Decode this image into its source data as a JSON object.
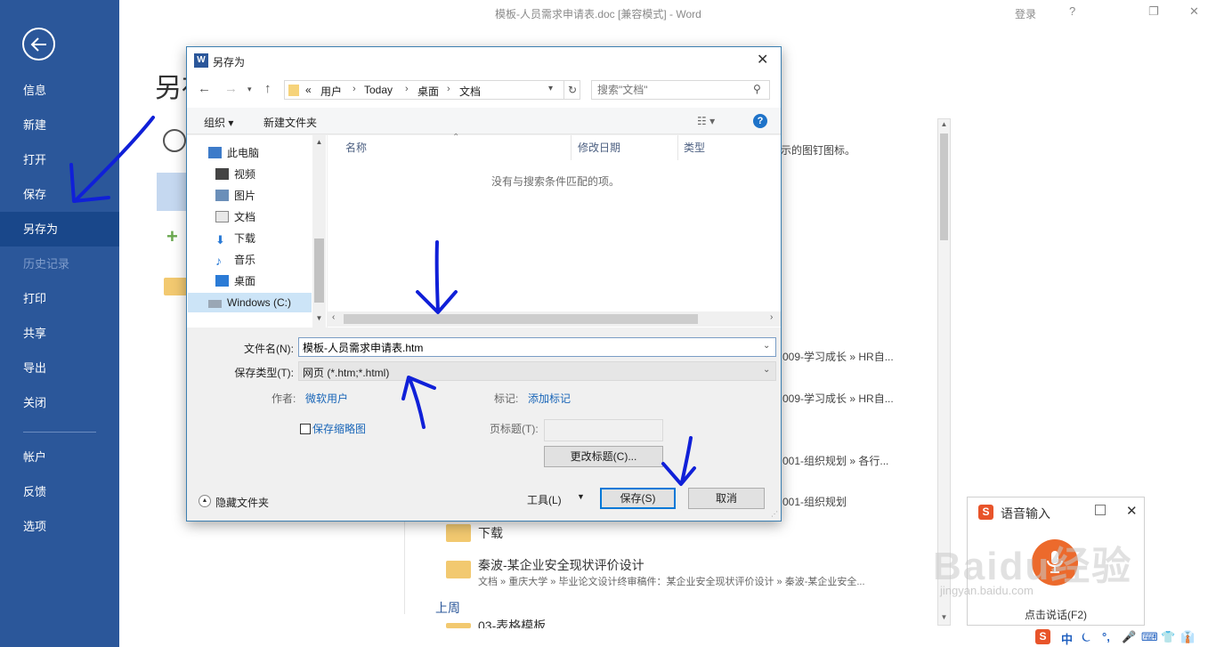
{
  "window": {
    "title": "模板-人员需求申请表.doc [兼容模式]  -  Word",
    "login": "登录",
    "help": "?",
    "restore": "❐",
    "close": "✕"
  },
  "backstage": {
    "heading": "另存",
    "nav": [
      {
        "label": "信息"
      },
      {
        "label": "新建"
      },
      {
        "label": "打开"
      },
      {
        "label": "保存"
      },
      {
        "label": "另存为"
      },
      {
        "label": "历史记录"
      },
      {
        "label": "打印"
      },
      {
        "label": "共享"
      },
      {
        "label": "导出"
      },
      {
        "label": "关闭"
      },
      {
        "label": "帐户"
      },
      {
        "label": "反馈"
      },
      {
        "label": "选项"
      }
    ],
    "pin_tip": "示的图钉图标。",
    "recent": [
      {
        "path": "009-学习成长 » HR自..."
      },
      {
        "path": "009-学习成长 » HR自..."
      },
      {
        "path": "001-组织规划 » 各行..."
      },
      {
        "path": "001-组织规划"
      }
    ],
    "folder_download": "下载",
    "folder_qinbo": "秦波-某企业安全现状评价设计",
    "folder_qinbo_path": "文档 » 重庆大学 » 毕业论文设计终审稿件：某企业安全现状评价设计 » 秦波-某企业安全...",
    "group_last_week": "上周",
    "folder_partial": "03-表格模板"
  },
  "dialog": {
    "title": "另存为",
    "close": "✕",
    "breadcrumb": {
      "overflow": "«",
      "items": [
        "用户",
        "Today",
        "桌面",
        "文档"
      ]
    },
    "search_placeholder": "搜索\"文档\"",
    "toolbar": {
      "organize": "组织 ▾",
      "new_folder": "新建文件夹",
      "help": "?"
    },
    "tree": [
      {
        "label": "此电脑",
        "icon": "computer-icon"
      },
      {
        "label": "视频",
        "icon": "video-icon"
      },
      {
        "label": "图片",
        "icon": "picture-icon"
      },
      {
        "label": "文档",
        "icon": "document-icon"
      },
      {
        "label": "下载",
        "icon": "download-icon"
      },
      {
        "label": "音乐",
        "icon": "music-icon"
      },
      {
        "label": "桌面",
        "icon": "desktop-icon"
      },
      {
        "label": "Windows (C:)",
        "icon": "drive-icon"
      }
    ],
    "columns": [
      "名称",
      "修改日期",
      "类型"
    ],
    "empty_message": "没有与搜索条件匹配的项。",
    "filename_label": "文件名(N):",
    "filename_value": "模板-人员需求申请表.htm",
    "savetype_label": "保存类型(T):",
    "savetype_value": "网页 (*.htm;*.html)",
    "author_label": "作者:",
    "author_value": "微软用户",
    "tags_label": "标记:",
    "tags_value": "添加标记",
    "thumbnail_label": "保存缩略图",
    "pagetitle_label": "页标题(T):",
    "change_title_button": "更改标题(C)...",
    "hide_folders": "隐藏文件夹",
    "tools": "工具(L)",
    "save_button": "保存(S)",
    "cancel_button": "取消"
  },
  "voice_input": {
    "title": "语音输入",
    "hint": "点击说话(F2)",
    "close": "✕"
  },
  "ime_bar": {
    "items": [
      "中",
      "⏾",
      "°,",
      "🎤",
      "⌨",
      "👕",
      "👔"
    ]
  },
  "watermark": {
    "main": "Baidu经验",
    "sub": "jingyan.baidu.com"
  }
}
